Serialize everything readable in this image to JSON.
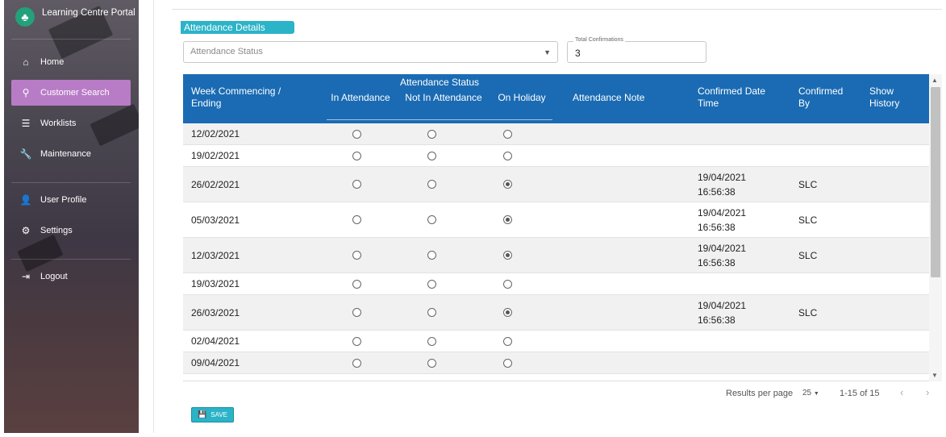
{
  "app": {
    "title": "Learning Centre Portal",
    "logo_icon": "tree-icon"
  },
  "nav": {
    "items": [
      {
        "label": "Home",
        "icon": "home-icon",
        "glyph": "⌂"
      },
      {
        "label": "Customer Search",
        "icon": "search-icon",
        "glyph": "⚲"
      },
      {
        "label": "Worklists",
        "icon": "list-icon",
        "glyph": "☰"
      },
      {
        "label": "Maintenance",
        "icon": "wrench-icon",
        "glyph": "🔧"
      },
      {
        "label": "User Profile",
        "icon": "user-icon",
        "glyph": "👤"
      },
      {
        "label": "Settings",
        "icon": "gear-icon",
        "glyph": "⚙"
      },
      {
        "label": "Logout",
        "icon": "logout-icon",
        "glyph": "⇥"
      }
    ],
    "active": "Customer Search",
    "active_color": "#b87cc6"
  },
  "section": {
    "title": "Attendance Details",
    "accent": "#2bb3c8"
  },
  "filters": {
    "status_placeholder": "Attendance Status",
    "total_label": "Total Confirmations",
    "total_value": "3"
  },
  "table": {
    "header_color": "#1a6bb3",
    "headers": {
      "week": "Week Commencing / Ending",
      "group": "Attendance Status",
      "in": "In Attendance",
      "not_in": "Not In Attendance",
      "holiday": "On Holiday",
      "note": "Attendance Note",
      "confirmed_dt": "Confirmed Date Time",
      "confirmed_by": "Confirmed By",
      "history": "Show History"
    },
    "rows": [
      {
        "week": "12/02/2021",
        "status": "none",
        "date": "",
        "time": "",
        "by": ""
      },
      {
        "week": "19/02/2021",
        "status": "none",
        "date": "",
        "time": "",
        "by": ""
      },
      {
        "week": "26/02/2021",
        "status": "holiday",
        "date": "19/04/2021",
        "time": "16:56:38",
        "by": "SLC"
      },
      {
        "week": "05/03/2021",
        "status": "holiday",
        "date": "19/04/2021",
        "time": "16:56:38",
        "by": "SLC"
      },
      {
        "week": "12/03/2021",
        "status": "holiday",
        "date": "19/04/2021",
        "time": "16:56:38",
        "by": "SLC"
      },
      {
        "week": "19/03/2021",
        "status": "none",
        "date": "",
        "time": "",
        "by": ""
      },
      {
        "week": "26/03/2021",
        "status": "holiday",
        "date": "19/04/2021",
        "time": "16:56:38",
        "by": "SLC"
      },
      {
        "week": "02/04/2021",
        "status": "none",
        "date": "",
        "time": "",
        "by": ""
      },
      {
        "week": "09/04/2021",
        "status": "none",
        "date": "",
        "time": "",
        "by": ""
      }
    ]
  },
  "pagination": {
    "label": "Results per page",
    "per_page": "25",
    "range": "1-15 of 15"
  },
  "save_label": "SAVE"
}
